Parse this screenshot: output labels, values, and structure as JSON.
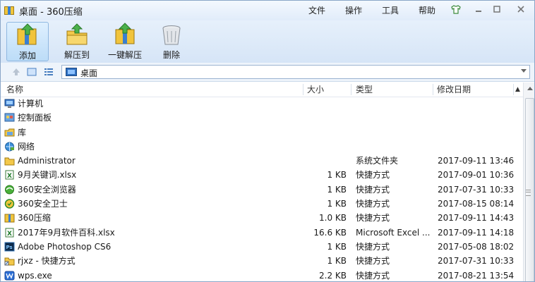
{
  "window": {
    "title": "桌面 - 360压缩",
    "app_icon": "360zip-app-icon"
  },
  "menu": [
    "文件",
    "操作",
    "工具",
    "帮助"
  ],
  "window_controls": {
    "skin": "shirt-icon",
    "minimize": "minimize-icon",
    "maximize": "maximize-icon",
    "close": "close-icon"
  },
  "toolbar": {
    "add_label": "添加",
    "extract_label": "解压到",
    "oneclick_label": "一键解压",
    "delete_label": "删除"
  },
  "address": {
    "path": "桌面"
  },
  "columns": {
    "name": "名称",
    "size": "大小",
    "type": "类型",
    "date": "修改日期"
  },
  "files": [
    {
      "icon": "computer-icon",
      "name": "计算机",
      "size": "",
      "type": "",
      "date": ""
    },
    {
      "icon": "control-panel-icon",
      "name": "控制面板",
      "size": "",
      "type": "",
      "date": ""
    },
    {
      "icon": "library-icon",
      "name": "库",
      "size": "",
      "type": "",
      "date": ""
    },
    {
      "icon": "network-icon",
      "name": "网络",
      "size": "",
      "type": "",
      "date": ""
    },
    {
      "icon": "folder-icon",
      "name": "Administrator",
      "size": "",
      "type": "系统文件夹",
      "date": "2017-09-11 13:46"
    },
    {
      "icon": "excel-icon",
      "name": "9月关键词.xlsx",
      "size": "1 KB",
      "type": "快捷方式",
      "date": "2017-09-01 10:36"
    },
    {
      "icon": "browser-icon",
      "name": "360安全浏览器",
      "size": "1 KB",
      "type": "快捷方式",
      "date": "2017-07-31 10:33"
    },
    {
      "icon": "guard-icon",
      "name": "360安全卫士",
      "size": "1 KB",
      "type": "快捷方式",
      "date": "2017-08-15 08:14"
    },
    {
      "icon": "360zip-icon",
      "name": "360压缩",
      "size": "1.0 KB",
      "type": "快捷方式",
      "date": "2017-09-11 14:43"
    },
    {
      "icon": "excel-icon",
      "name": "2017年9月软件百科.xlsx",
      "size": "16.6 KB",
      "type": "Microsoft Excel ...",
      "date": "2017-09-11 14:18"
    },
    {
      "icon": "photoshop-icon",
      "name": "Adobe Photoshop CS6",
      "size": "1 KB",
      "type": "快捷方式",
      "date": "2017-05-08 18:02"
    },
    {
      "icon": "folder-shortcut-icon",
      "name": "rjxz - 快捷方式",
      "size": "1 KB",
      "type": "快捷方式",
      "date": "2017-07-31 10:33"
    },
    {
      "icon": "wps-icon",
      "name": "wps.exe",
      "size": "2.2 KB",
      "type": "快捷方式",
      "date": "2017-08-21 13:54"
    }
  ],
  "colors": {
    "accent": "#3a7fd0",
    "toolbar_bg": "#dbe8f8",
    "active_button": "#bcdcf7"
  }
}
